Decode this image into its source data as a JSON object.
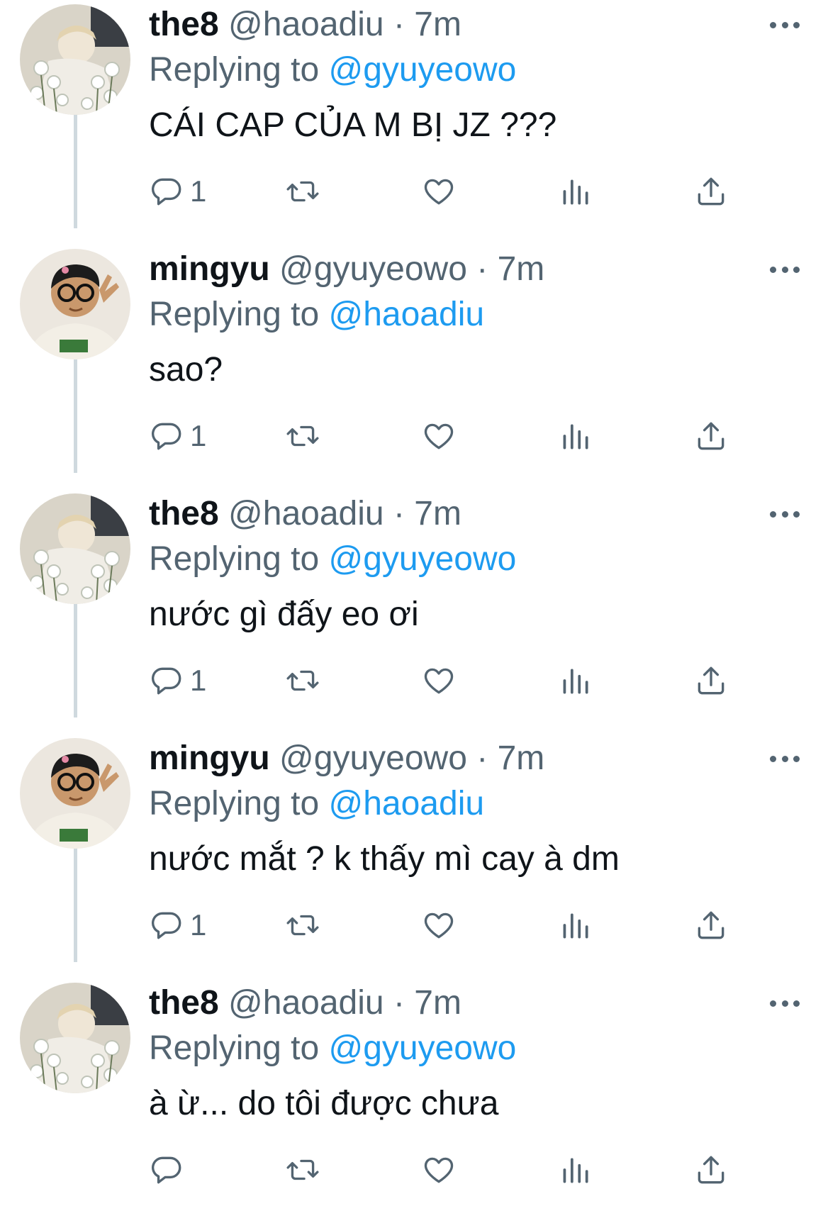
{
  "tweets": [
    {
      "name": "the8",
      "handle": "@haoadiu",
      "separator": "·",
      "time": "7m",
      "replying_prefix": "Replying to",
      "replying_to": "@gyuyeowo",
      "text": "CÁI CAP CỦA M BỊ JZ ???",
      "reply_count": "1",
      "avatar": "avatar-the8"
    },
    {
      "name": "mingyu",
      "handle": "@gyuyeowo",
      "separator": "·",
      "time": "7m",
      "replying_prefix": "Replying to",
      "replying_to": "@haoadiu",
      "text": "sao?",
      "reply_count": "1",
      "avatar": "avatar-mingyu"
    },
    {
      "name": "the8",
      "handle": "@haoadiu",
      "separator": "·",
      "time": "7m",
      "replying_prefix": "Replying to",
      "replying_to": "@gyuyeowo",
      "text": "nước gì đấy eo ơi",
      "reply_count": "1",
      "avatar": "avatar-the8"
    },
    {
      "name": "mingyu",
      "handle": "@gyuyeowo",
      "separator": "·",
      "time": "7m",
      "replying_prefix": "Replying to",
      "replying_to": "@haoadiu",
      "text": "nước mắt ? k thấy mì cay à dm",
      "reply_count": "1",
      "avatar": "avatar-mingyu"
    },
    {
      "name": "the8",
      "handle": "@haoadiu",
      "separator": "·",
      "time": "7m",
      "replying_prefix": "Replying to",
      "replying_to": "@gyuyeowo",
      "text": "à ừ... do tôi được chưa",
      "reply_count": "",
      "avatar": "avatar-the8"
    }
  ],
  "icons": {
    "reply": "reply-icon",
    "retweet": "retweet-icon",
    "like": "like-icon",
    "views": "views-icon",
    "share": "share-icon",
    "more": "more-icon"
  },
  "colors": {
    "mention": "#1d9bf0",
    "secondary_text": "#536471",
    "thread_line": "#cfd9de"
  }
}
